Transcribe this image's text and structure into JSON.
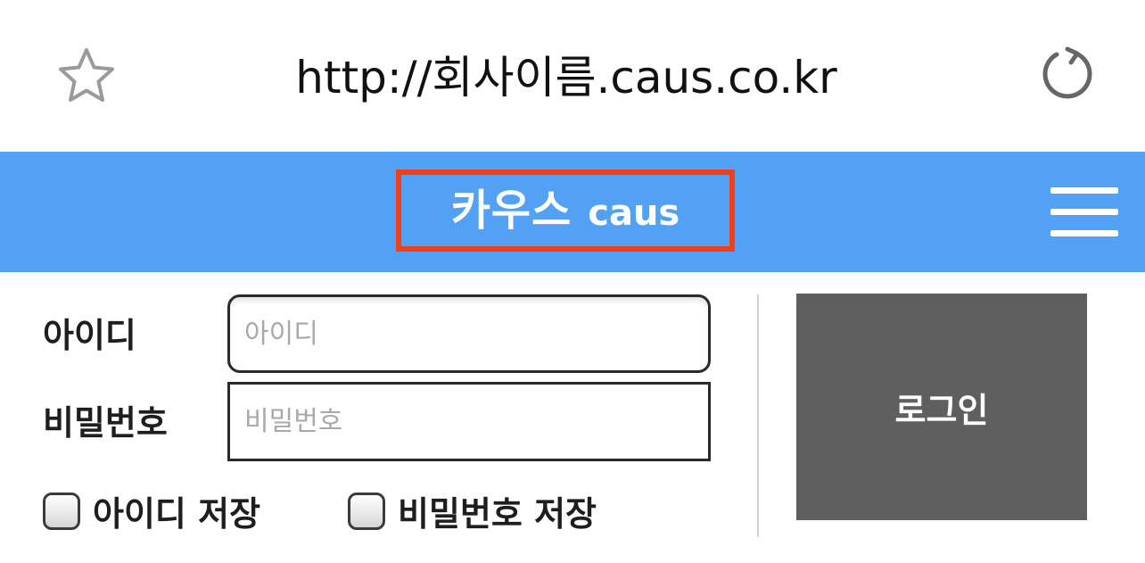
{
  "browser": {
    "url": "http://회사이름.caus.co.kr",
    "icons": {
      "bookmark": "star-icon",
      "reload": "reload-icon"
    }
  },
  "header": {
    "logo_ko": "카우스",
    "logo_en": "caus",
    "menu_icon": "hamburger-menu-icon",
    "background_color": "#52a1f5",
    "highlight_color": "#f23f1b"
  },
  "login": {
    "id_label": "아이디",
    "id_placeholder": "아이디",
    "id_value": "",
    "pw_label": "비밀번호",
    "pw_placeholder": "비밀번호",
    "pw_value": "",
    "save_id_label": "아이디 저장",
    "save_id_checked": false,
    "save_pw_label": "비밀번호 저장",
    "save_pw_checked": false,
    "submit_label": "로그인",
    "submit_color": "#5f5f5f"
  }
}
